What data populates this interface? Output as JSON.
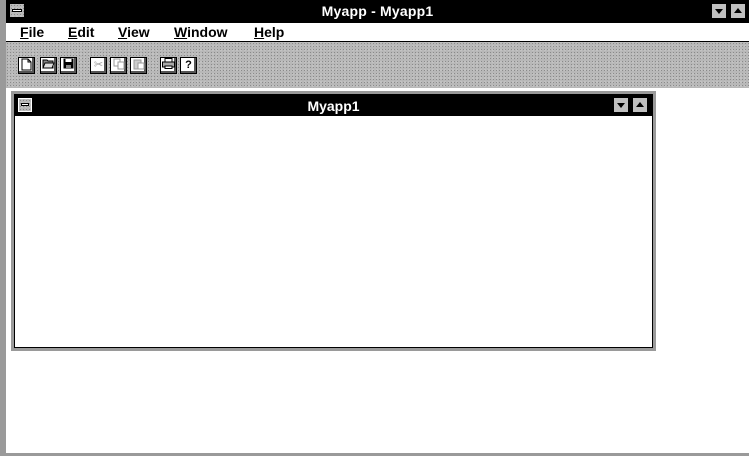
{
  "window": {
    "title": "Myapp - Myapp1"
  },
  "menu": {
    "items": [
      {
        "mnemonic": "F",
        "rest": "ile"
      },
      {
        "mnemonic": "E",
        "rest": "dit"
      },
      {
        "mnemonic": "V",
        "rest": "iew"
      },
      {
        "mnemonic": "W",
        "rest": "indow"
      },
      {
        "mnemonic": "H",
        "rest": "elp"
      }
    ]
  },
  "toolbar": {
    "tools": [
      {
        "icon": "new-document-icon",
        "glyph": ""
      },
      {
        "icon": "open-folder-icon",
        "glyph": ""
      },
      {
        "icon": "save-disk-icon",
        "glyph": ""
      },
      {
        "icon": "cut-scissors-icon",
        "glyph": "✂"
      },
      {
        "icon": "copy-icon",
        "glyph": ""
      },
      {
        "icon": "paste-icon",
        "glyph": ""
      },
      {
        "icon": "print-icon",
        "glyph": ""
      },
      {
        "icon": "help-icon",
        "glyph": "?"
      }
    ]
  },
  "child": {
    "title": "Myapp1"
  },
  "colors": {
    "titlebar": "#000000",
    "frame": "#9a9a9a"
  }
}
